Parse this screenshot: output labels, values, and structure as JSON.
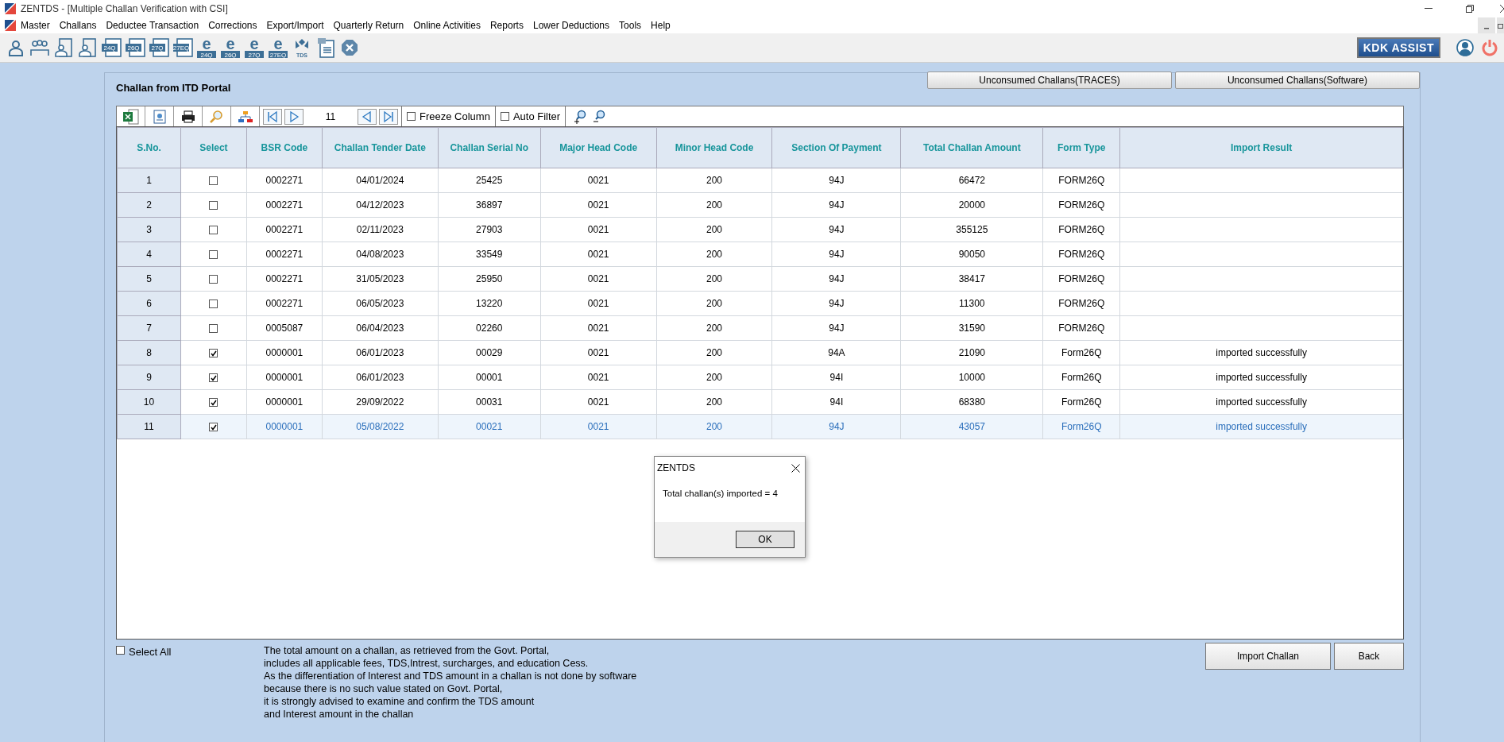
{
  "window": {
    "title": "ZENTDS - [Multiple Challan Verification with CSI]"
  },
  "menu": [
    "Master",
    "Challans",
    "Deductee Transaction",
    "Corrections",
    "Export/Import",
    "Quarterly Return",
    "Online Activities",
    "Reports",
    "Lower Deductions",
    "Tools",
    "Help"
  ],
  "toolbar": [
    {
      "kind": "person"
    },
    {
      "kind": "group"
    },
    {
      "kind": "doc-person"
    },
    {
      "kind": "doc-person"
    },
    {
      "kind": "form",
      "label": "24Q"
    },
    {
      "kind": "form",
      "label": "26Q"
    },
    {
      "kind": "form",
      "label": "27Q"
    },
    {
      "kind": "form",
      "label": "27EQ"
    },
    {
      "kind": "e",
      "label": "24Q"
    },
    {
      "kind": "e",
      "label": "26Q"
    },
    {
      "kind": "e",
      "label": "27Q"
    },
    {
      "kind": "e",
      "label": "27EQ"
    },
    {
      "kind": "tds",
      "label": "TDS"
    },
    {
      "kind": "pdf"
    },
    {
      "kind": "close"
    }
  ],
  "assist_button": "KDK ASSIST",
  "panel": {
    "title": "Challan from ITD Portal",
    "tabs": [
      "Unconsumed Challans(TRACES)",
      "Unconsumed Challans(Software)"
    ]
  },
  "grid_toolbar": {
    "record": "11",
    "freeze_column": {
      "label": "Freeze Column",
      "checked": false
    },
    "auto_filter": {
      "label": "Auto Filter",
      "checked": false
    }
  },
  "table": {
    "columns": [
      "S.No.",
      "Select",
      "BSR Code",
      "Challan Tender Date",
      "Challan Serial No",
      "Major Head Code",
      "Minor Head Code",
      "Section Of Payment",
      "Total Challan Amount",
      "Form Type",
      "Import Result"
    ],
    "rows": [
      {
        "cells": [
          "1",
          "",
          "0002271",
          "04/01/2024",
          "25425",
          "0021",
          "200",
          "94J",
          "66472",
          "FORM26Q"
        ],
        "checked": false,
        "selected": false
      },
      {
        "cells": [
          "2",
          "",
          "0002271",
          "04/12/2023",
          "36897",
          "0021",
          "200",
          "94J",
          "20000",
          "FORM26Q"
        ],
        "checked": false,
        "selected": false
      },
      {
        "cells": [
          "3",
          "",
          "0002271",
          "02/11/2023",
          "27903",
          "0021",
          "200",
          "94J",
          "355125",
          "FORM26Q"
        ],
        "checked": false,
        "selected": false
      },
      {
        "cells": [
          "4",
          "",
          "0002271",
          "04/08/2023",
          "33549",
          "0021",
          "200",
          "94J",
          "90050",
          "FORM26Q"
        ],
        "checked": false,
        "selected": false
      },
      {
        "cells": [
          "5",
          "",
          "0002271",
          "31/05/2023",
          "25950",
          "0021",
          "200",
          "94J",
          "38417",
          "FORM26Q"
        ],
        "checked": false,
        "selected": false
      },
      {
        "cells": [
          "6",
          "",
          "0002271",
          "06/05/2023",
          "13220",
          "0021",
          "200",
          "94J",
          "11300",
          "FORM26Q"
        ],
        "checked": false,
        "selected": false
      },
      {
        "cells": [
          "7",
          "",
          "0005087",
          "06/04/2023",
          "02260",
          "0021",
          "200",
          "94J",
          "31590",
          "FORM26Q"
        ],
        "checked": false,
        "selected": false
      },
      {
        "cells": [
          "8",
          "",
          "0000001",
          "06/01/2023",
          "00029",
          "0021",
          "200",
          "94A",
          "21090",
          "Form26Q",
          "imported successfully"
        ],
        "checked": true,
        "selected": false
      },
      {
        "cells": [
          "9",
          "",
          "0000001",
          "06/01/2023",
          "00001",
          "0021",
          "200",
          "94I",
          "10000",
          "Form26Q",
          "imported successfully"
        ],
        "checked": true,
        "selected": false
      },
      {
        "cells": [
          "10",
          "",
          "0000001",
          "29/09/2022",
          "00031",
          "0021",
          "200",
          "94I",
          "68380",
          "Form26Q",
          "imported successfully"
        ],
        "checked": true,
        "selected": false
      },
      {
        "cells": [
          "11",
          "",
          "0000001",
          "05/08/2022",
          "00021",
          "0021",
          "200",
          "94J",
          "43057",
          "Form26Q",
          "imported successfully"
        ],
        "checked": true,
        "selected": true
      }
    ]
  },
  "select_all": {
    "label": "Select All",
    "checked": false
  },
  "note": [
    "The total amount on a challan, as retrieved from the Govt. Portal,",
    "includes all applicable fees, TDS,Intrest, surcharges, and education Cess.",
    "As the differentiation of Interest and TDS amount in a challan is not done by software",
    "because there is no such value stated on Govt. Portal,",
    "it is strongly advised to examine and confirm the TDS amount",
    "and Interest amount in the challan"
  ],
  "buttons": [
    "Import Challan",
    "Back"
  ],
  "dialog": {
    "title": "ZENTDS",
    "message": "Total challan(s) imported = 4",
    "button": "OK"
  }
}
